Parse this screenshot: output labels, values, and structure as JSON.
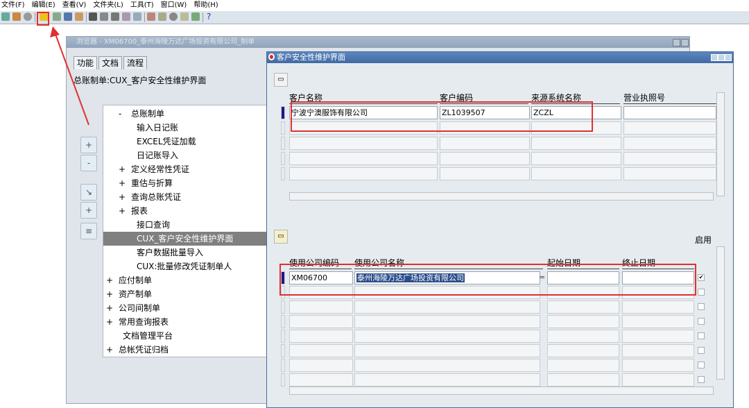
{
  "menu": [
    "文件(F)",
    "编辑(E)",
    "查看(V)",
    "文件夹(L)",
    "工具(T)",
    "窗口(W)",
    "帮助(H)"
  ],
  "toolbar": {
    "help_glyph": "?"
  },
  "navigator": {
    "title": "浏览器 - XM06700_泰州海陵万达广场投资有限公司_制单",
    "tabs": [
      "功能",
      "文档",
      "流程"
    ],
    "label": "总账制单:CUX_客户安全性维护界面",
    "tree": [
      {
        "pm": "-",
        "label": "总账制单",
        "indent": 1
      },
      {
        "pm": "",
        "label": "输入日记账",
        "indent": 2
      },
      {
        "pm": "",
        "label": "EXCEL凭证加载",
        "indent": 2
      },
      {
        "pm": "",
        "label": "日记账导入",
        "indent": 2
      },
      {
        "pm": "+",
        "label": "定义经常性凭证",
        "indent": 1
      },
      {
        "pm": "+",
        "label": "重估与折算",
        "indent": 1
      },
      {
        "pm": "+",
        "label": "查询总账凭证",
        "indent": 1
      },
      {
        "pm": "+",
        "label": "报表",
        "indent": 1
      },
      {
        "pm": "",
        "label": "接口查询",
        "indent": 2
      },
      {
        "pm": "",
        "label": "CUX_客户安全性维护界面",
        "indent": 2,
        "selected": true
      },
      {
        "pm": "",
        "label": "客户数据批量导入",
        "indent": 2
      },
      {
        "pm": "",
        "label": "CUX:批量修改凭证制单人",
        "indent": 2
      },
      {
        "pm": "+",
        "label": "应付制单",
        "indent": 0
      },
      {
        "pm": "+",
        "label": "资产制单",
        "indent": 0
      },
      {
        "pm": "+",
        "label": "公司间制单",
        "indent": 0
      },
      {
        "pm": "+",
        "label": "常用查询报表",
        "indent": 0
      },
      {
        "pm": "",
        "label": "文档管理平台",
        "indent": 0
      },
      {
        "pm": "+",
        "label": "总帐凭证归档",
        "indent": 0
      }
    ],
    "side_buttons": [
      "+",
      "-",
      "↘",
      "+",
      "≡"
    ]
  },
  "dialog": {
    "title": "客户安全性维护界面",
    "top_table": {
      "headers": [
        "客户名称",
        "客户编码",
        "来源系统名称",
        "营业执照号"
      ],
      "rows": [
        [
          "宁波宁澳服饰有限公司",
          "ZL1039507",
          "ZCZL",
          ""
        ]
      ]
    },
    "bottom_table": {
      "headers": [
        "使用公司编码",
        "使用公司名称",
        "起始日期",
        "终止日期",
        "启用"
      ],
      "rows": [
        [
          "XM06700",
          "泰州海陵万达广场投资有限公司",
          "",
          "",
          true
        ]
      ],
      "lov_glyph": "="
    }
  },
  "colors": {
    "accent_red": "#e03030",
    "title_blue": "#3f6aa5",
    "current_row": "#1a1a8a"
  }
}
